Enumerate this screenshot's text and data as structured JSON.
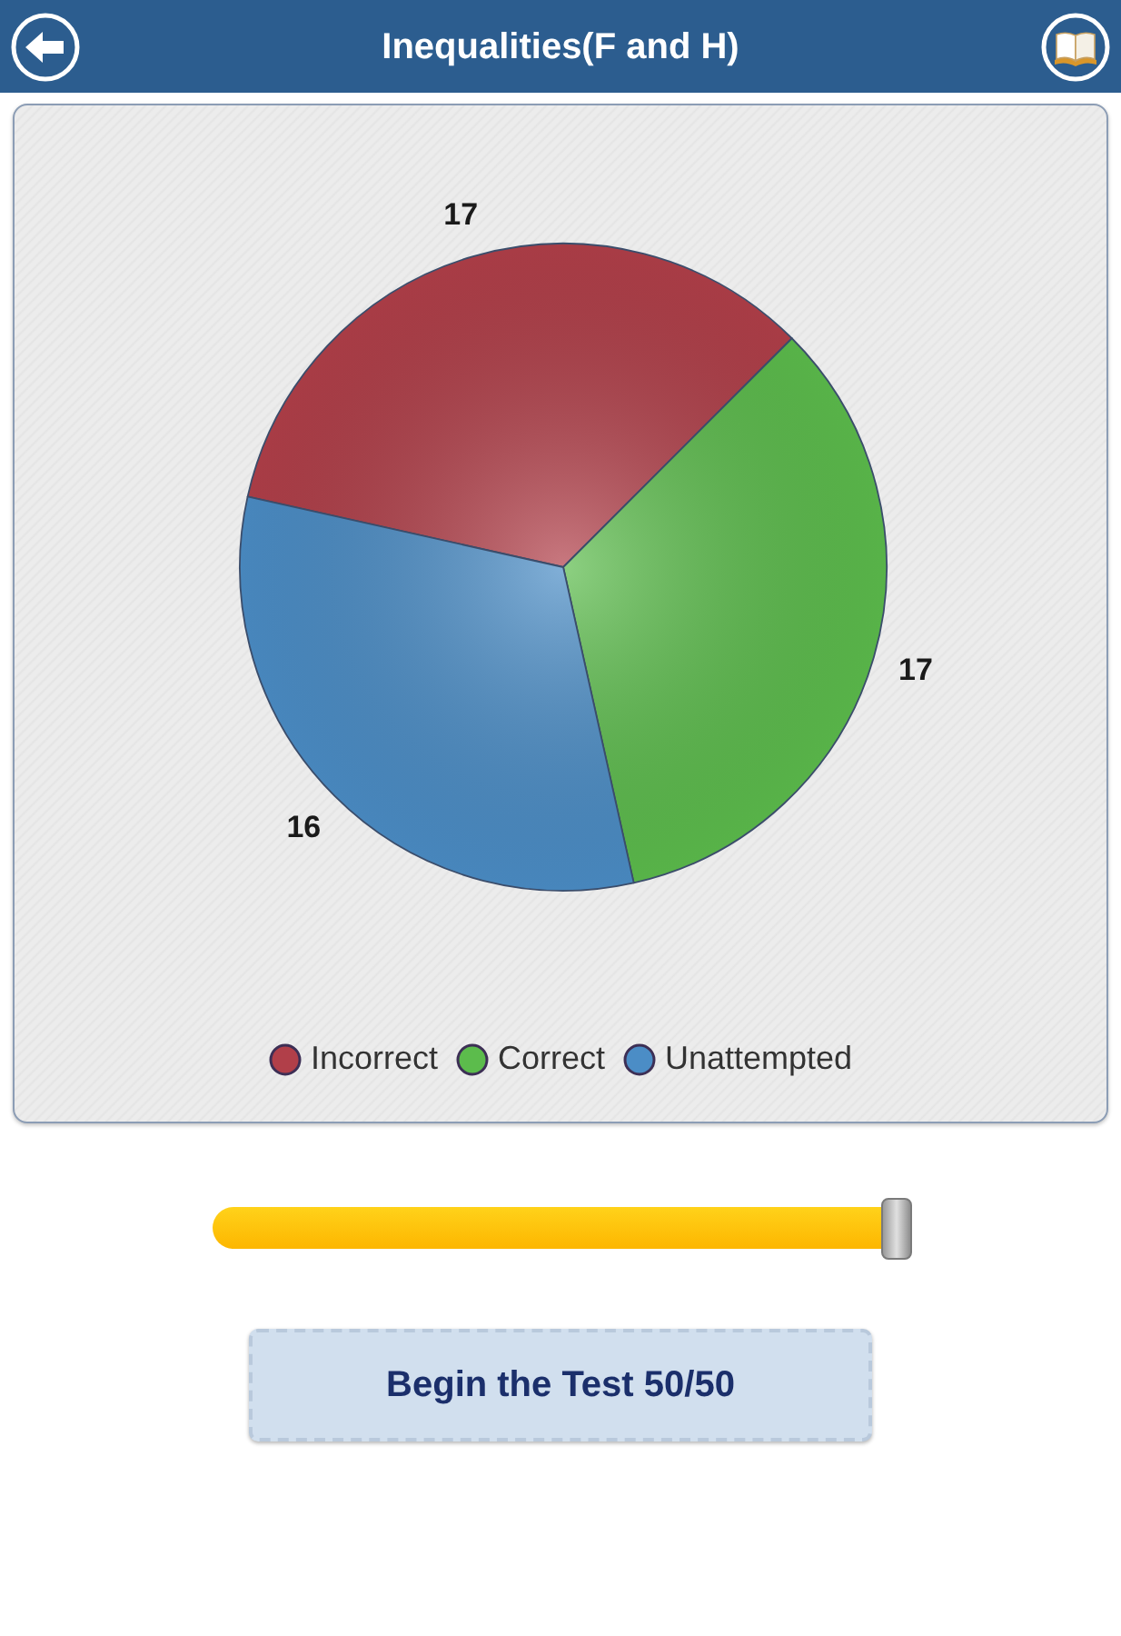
{
  "header": {
    "title": "Inequalities(F and H)"
  },
  "results_card": {
    "chart_data": {
      "type": "pie",
      "categories": [
        "Incorrect",
        "Correct",
        "Unattempted"
      ],
      "values": [
        17,
        17,
        16
      ],
      "colors": [
        "#b13f49",
        "#5cbc4c",
        "#4b8dc6"
      ],
      "data_labels": true
    }
  },
  "slider": {
    "level": 1
  },
  "begin_button": {
    "label": "Begin the Test 50/50"
  }
}
